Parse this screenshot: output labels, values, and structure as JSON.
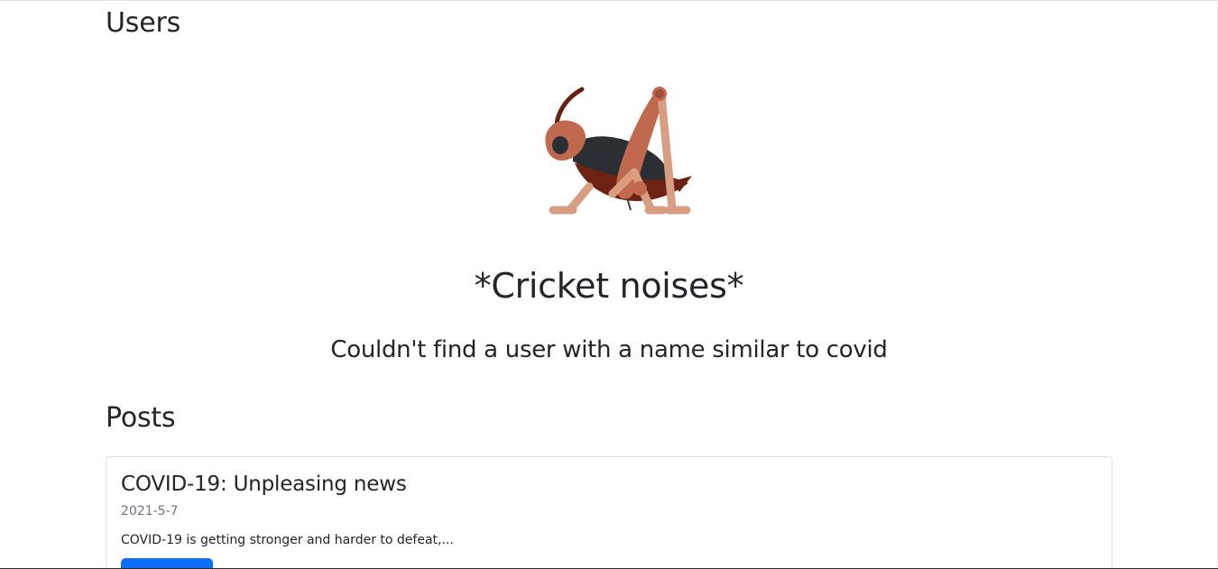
{
  "users_section": {
    "heading": "Users",
    "empty_state": {
      "icon": "cricket-icon",
      "title": "*Cricket noises*",
      "message": "Couldn't find a user with a name similar to covid"
    }
  },
  "posts_section": {
    "heading": "Posts",
    "posts": [
      {
        "title": "COVID-19: Unpleasing news",
        "date": "2021-5-7",
        "excerpt": "COVID-19 is getting stronger and harder to defeat,..."
      }
    ]
  },
  "colors": {
    "primary_button": "#0d6efd",
    "muted_text": "#6c757d",
    "heading_text": "#212529"
  }
}
